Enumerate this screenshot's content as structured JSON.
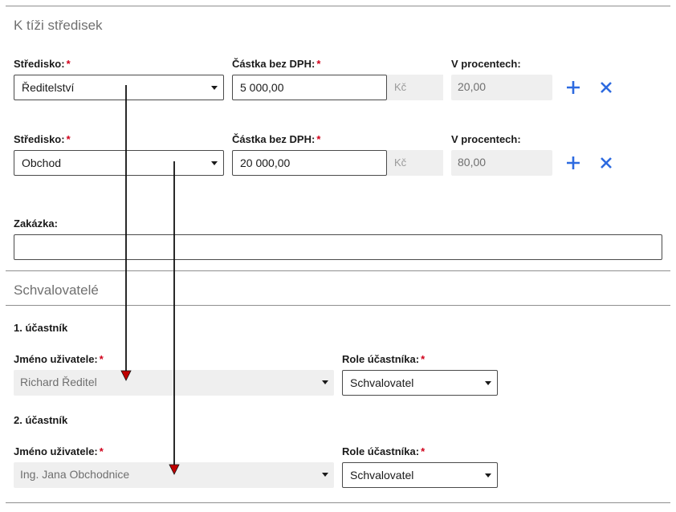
{
  "cost_centers": {
    "title": "K tíži středisek",
    "center_label": "Středisko:",
    "amount_label": "Částka bez DPH:",
    "percent_label": "V procentech:",
    "currency": "Kč",
    "rows": [
      {
        "center": "Ředitelství",
        "amount": "5 000,00",
        "percent": "20,00"
      },
      {
        "center": "Obchod",
        "amount": "20 000,00",
        "percent": "80,00"
      }
    ]
  },
  "order": {
    "label": "Zakázka:",
    "value": ""
  },
  "approvers": {
    "title": "Schvalovatelé",
    "user_label": "Jméno uživatele:",
    "role_label": "Role účastníka:",
    "participants": [
      {
        "heading": "1. účastník",
        "user": "Richard Ředitel",
        "role": "Schvalovatel"
      },
      {
        "heading": "2. účastník",
        "user": "Ing. Jana Obchodnice",
        "role": "Schvalovatel"
      }
    ]
  },
  "required_mark": "*",
  "colors": {
    "accent": "#2d6ae0",
    "required": "#d0021b",
    "arrow": "#c00000"
  },
  "icons": {
    "add": "plus-icon",
    "remove": "close-icon",
    "dropdown": "chevron-down-icon"
  }
}
